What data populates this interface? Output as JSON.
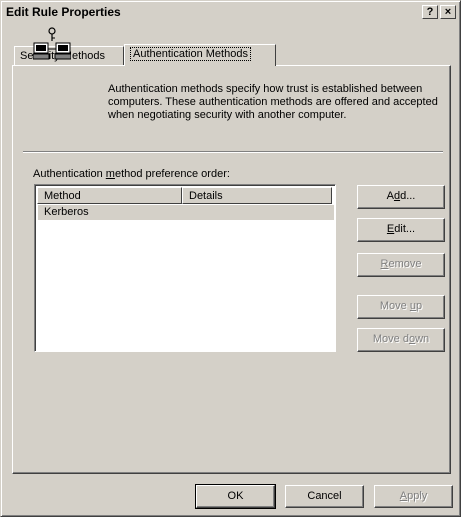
{
  "window": {
    "title": "Edit Rule Properties",
    "help_glyph": "?",
    "close_glyph": "×"
  },
  "tabs": [
    {
      "label": "Security Methods"
    },
    {
      "label": "Authentication Methods"
    }
  ],
  "description": "Authentication methods specify how trust is established between computers. These authentication methods are offered and accepted when negotiating security with another computer.",
  "preference": {
    "label_pre": "Authentication ",
    "label_access": "m",
    "label_post": "ethod preference order:"
  },
  "list": {
    "columns": [
      "Method",
      "Details"
    ],
    "rows": [
      {
        "method": "Kerberos",
        "details": ""
      }
    ]
  },
  "buttons": {
    "add": {
      "pre": "A",
      "access": "d",
      "post": "d..."
    },
    "edit": {
      "pre": "",
      "access": "E",
      "post": "dit..."
    },
    "remove": {
      "pre": "",
      "access": "R",
      "post": "emove"
    },
    "move_up": {
      "pre": "Move ",
      "access": "u",
      "post": "p"
    },
    "move_down": {
      "pre": "Move d",
      "access": "o",
      "post": "wn"
    }
  },
  "footer": {
    "ok": "OK",
    "cancel": "Cancel",
    "apply": {
      "pre": "",
      "access": "A",
      "post": "pply"
    }
  }
}
